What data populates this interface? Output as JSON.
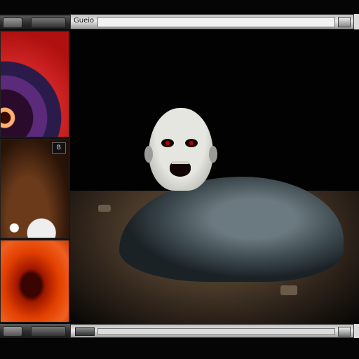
{
  "window": {
    "address_label": "Gueio"
  },
  "thumbnails": [
    {
      "name": "thumb-1",
      "label": ""
    },
    {
      "name": "thumb-2",
      "label": "B"
    },
    {
      "name": "thumb-3",
      "label": ""
    }
  ],
  "icons": {
    "top_nav": "chevron-right-icon",
    "bottom_nav": "chevron-right-icon"
  }
}
